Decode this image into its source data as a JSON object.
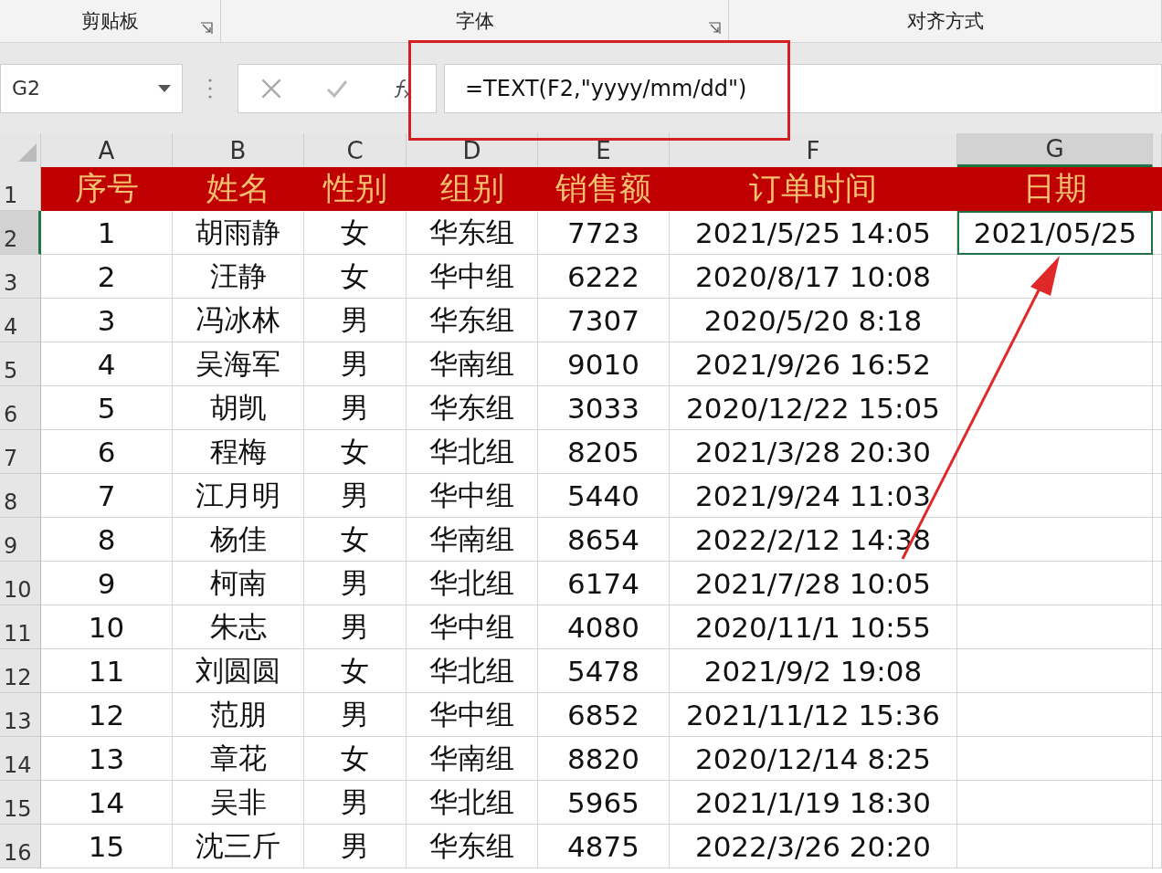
{
  "ribbon_groups": [
    {
      "label": "剪贴板",
      "launcher": true
    },
    {
      "label": "字体",
      "launcher": true
    },
    {
      "label": "对齐方式",
      "launcher": false
    }
  ],
  "name_box": "G2",
  "formula": "=TEXT(F2,\"yyyy/mm/dd\")",
  "columns": [
    {
      "label": "A",
      "selected": false
    },
    {
      "label": "B",
      "selected": false
    },
    {
      "label": "C",
      "selected": false
    },
    {
      "label": "D",
      "selected": false
    },
    {
      "label": "E",
      "selected": false
    },
    {
      "label": "F",
      "selected": false
    },
    {
      "label": "G",
      "selected": true
    }
  ],
  "rows": [
    {
      "number": "1",
      "kind": "header",
      "selected": false,
      "cells": [
        "序号",
        "姓名",
        "性别",
        "组别",
        "销售额",
        "订单时间",
        "日期"
      ]
    },
    {
      "number": "2",
      "kind": "data",
      "selected": true,
      "cells": [
        "1",
        "胡雨静",
        "女",
        "华东组",
        "7723",
        "2021/5/25 14:05",
        "2021/05/25"
      ]
    },
    {
      "number": "3",
      "kind": "data",
      "selected": false,
      "cells": [
        "2",
        "汪静",
        "女",
        "华中组",
        "6222",
        "2020/8/17 10:08"
      ]
    },
    {
      "number": "4",
      "kind": "data",
      "selected": false,
      "cells": [
        "3",
        "冯冰林",
        "男",
        "华东组",
        "7307",
        "2020/5/20 8:18"
      ]
    },
    {
      "number": "5",
      "kind": "data",
      "selected": false,
      "cells": [
        "4",
        "吴海军",
        "男",
        "华南组",
        "9010",
        "2021/9/26 16:52"
      ]
    },
    {
      "number": "6",
      "kind": "data",
      "selected": false,
      "cells": [
        "5",
        "胡凯",
        "男",
        "华东组",
        "3033",
        "2020/12/22 15:05"
      ]
    },
    {
      "number": "7",
      "kind": "data",
      "selected": false,
      "cells": [
        "6",
        "程梅",
        "女",
        "华北组",
        "8205",
        "2021/3/28 20:30"
      ]
    },
    {
      "number": "8",
      "kind": "data",
      "selected": false,
      "cells": [
        "7",
        "江月明",
        "男",
        "华中组",
        "5440",
        "2021/9/24 11:03"
      ]
    },
    {
      "number": "9",
      "kind": "data",
      "selected": false,
      "cells": [
        "8",
        "杨佳",
        "女",
        "华南组",
        "8654",
        "2022/2/12 14:38"
      ]
    },
    {
      "number": "10",
      "kind": "data",
      "selected": false,
      "cells": [
        "9",
        "柯南",
        "男",
        "华北组",
        "6174",
        "2021/7/28 10:05"
      ]
    },
    {
      "number": "11",
      "kind": "data",
      "selected": false,
      "cells": [
        "10",
        "朱志",
        "男",
        "华中组",
        "4080",
        "2020/11/1 10:55"
      ]
    },
    {
      "number": "12",
      "kind": "data",
      "selected": false,
      "cells": [
        "11",
        "刘圆圆",
        "女",
        "华北组",
        "5478",
        "2021/9/2 19:08"
      ]
    },
    {
      "number": "13",
      "kind": "data",
      "selected": false,
      "cells": [
        "12",
        "范朋",
        "男",
        "华中组",
        "6852",
        "2021/11/12 15:36"
      ]
    },
    {
      "number": "14",
      "kind": "data",
      "selected": false,
      "cells": [
        "13",
        "章花",
        "女",
        "华南组",
        "8820",
        "2020/12/14 8:25"
      ]
    },
    {
      "number": "15",
      "kind": "data",
      "selected": false,
      "cells": [
        "14",
        "吴非",
        "男",
        "华北组",
        "5965",
        "2021/1/19 18:30"
      ]
    },
    {
      "number": "16",
      "kind": "data",
      "selected": false,
      "cells": [
        "15",
        "沈三斤",
        "男",
        "华东组",
        "4875",
        "2022/3/26 20:20"
      ]
    }
  ]
}
